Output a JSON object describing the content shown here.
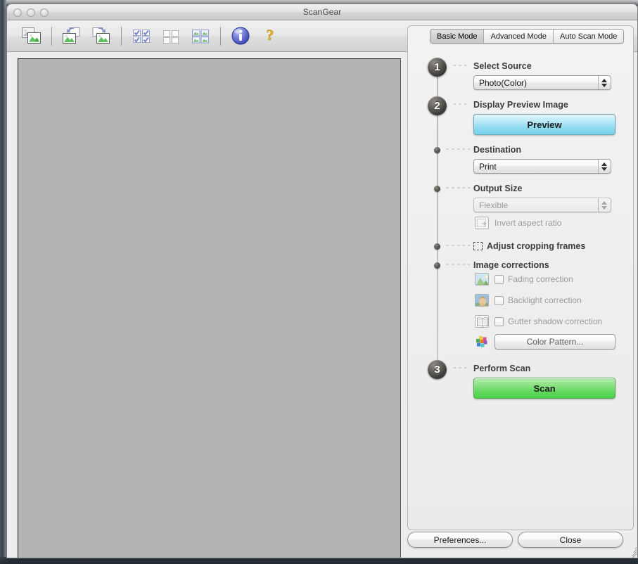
{
  "window": {
    "title": "ScanGear",
    "traffic_lights": [
      "close",
      "minimize",
      "zoom"
    ]
  },
  "toolbar": {
    "items": [
      {
        "name": "select-all-crop-frames-icon",
        "label": "Select All Crop Frames"
      },
      {
        "name": "rotate-left-icon",
        "label": "Rotate Left"
      },
      {
        "name": "rotate-right-icon",
        "label": "Rotate Right"
      },
      {
        "name": "check-all-images-icon",
        "label": "Check All Images"
      },
      {
        "name": "uncheck-all-images-icon",
        "label": "Uncheck All Images"
      },
      {
        "name": "select-all-images-icon",
        "label": "Select All Images"
      },
      {
        "name": "information-icon",
        "label": "Information"
      },
      {
        "name": "help-icon",
        "label": "Help"
      }
    ]
  },
  "preview": {
    "placeholder": ""
  },
  "panel": {
    "tabs": [
      {
        "label": "Basic Mode",
        "active": true
      },
      {
        "label": "Advanced Mode",
        "active": false
      },
      {
        "label": "Auto Scan Mode",
        "active": false
      }
    ],
    "steps": [
      {
        "marker": "1",
        "marker_type": "number",
        "dashes": "---",
        "title": "Select Source",
        "control": "select",
        "value": "Photo(Color)",
        "disabled": false
      },
      {
        "marker": "2",
        "marker_type": "number",
        "dashes": "---",
        "title": "Display Preview Image",
        "control": "button",
        "value": "Preview",
        "disabled": false
      },
      {
        "marker": "",
        "marker_type": "dot",
        "dashes": "------",
        "title": "Destination",
        "control": "select",
        "value": "Print",
        "disabled": false
      },
      {
        "marker": "",
        "marker_type": "dot",
        "dashes": "------",
        "title": "Output Size",
        "control": "select",
        "value": "Flexible",
        "disabled": true
      },
      {
        "marker": "",
        "marker_type": "dot",
        "dashes": "------",
        "title": "Adjust cropping frames",
        "control": "inline-checkbox",
        "value": "",
        "disabled": false
      },
      {
        "marker": "",
        "marker_type": "dot",
        "dashes": "------",
        "title": "Image corrections",
        "control": "group",
        "value": "",
        "disabled": false
      },
      {
        "marker": "3",
        "marker_type": "number",
        "dashes": "---",
        "title": "Perform Scan",
        "control": "button",
        "value": "Scan",
        "disabled": false
      }
    ],
    "invert_aspect_ratio": {
      "label": "Invert aspect ratio",
      "checked": false,
      "disabled": true,
      "icon": "invert-aspect-ratio-icon"
    },
    "corrections": [
      {
        "label": "Fading correction",
        "checked": false,
        "disabled": true,
        "icon": "landscape-thumbnail-icon"
      },
      {
        "label": "Backlight correction",
        "checked": false,
        "disabled": true,
        "icon": "portrait-thumbnail-icon"
      },
      {
        "label": "Gutter shadow correction",
        "checked": false,
        "disabled": true,
        "icon": "open-book-icon"
      }
    ],
    "color_pattern": {
      "label": "Color Pattern...",
      "icon": "color-swatches-icon",
      "disabled": true
    }
  },
  "footer": {
    "preferences_label": "Preferences...",
    "close_label": "Close"
  },
  "colors": {
    "preview_button": "#8ad9ef",
    "scan_button": "#5ed75a",
    "panel_bg": "#ededed",
    "preview_area": "#b3b3b3",
    "marker_dark": "#3a3935"
  }
}
